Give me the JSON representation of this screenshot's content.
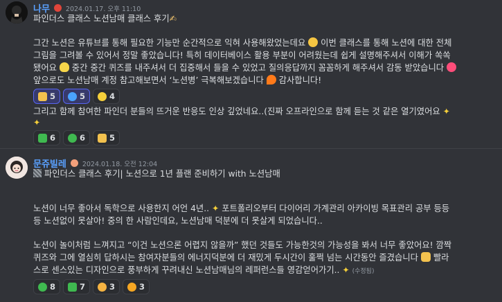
{
  "messages": [
    {
      "author": "나무",
      "timestamp": "2024.01.17. 오후 11:10",
      "lines": [
        "파인더스 클래스 노션남매 클래스 후기",
        "그간 노션은 유튜브를 통해 필요한 기능만 순간적으로 익혀 사용해왔었는데요",
        "이번 클래스를 통해 노션에 대한 전체",
        "그림을 그려볼 수 있어서 정말 좋았습니다! 특히 데이터베이스 활용 부분이 어려웠는데 쉽게 설명해주셔서 이해가 쏙쏙",
        "됐어요",
        "중간 중간 퀴즈를 내주셔서 더 집중해서 들을 수 있었고 질의응답까지 꼼꼼하게 해주셔서 감동 받았습니다",
        "앞으로도 노션남매 계정 참고해보면서 ‘노션병’ 극복해보겠습니다",
        "감사합니다!",
        "그리고 함께 참여한 파인더 분들의 뜨거운 반응도 인상 깊었네요..(진짜 오프라인으로 함께 듣는 것 같은 열기였어요"
      ],
      "reactions_row1": [
        {
          "icon": "thumbs-up",
          "count": "5"
        },
        {
          "icon": "blue-heart",
          "count": "5"
        },
        {
          "icon": "yellow-heart",
          "count": "4"
        }
      ],
      "reactions_row2": [
        {
          "icon": "sparkle",
          "count": "6"
        },
        {
          "icon": "green-heart",
          "count": "6"
        },
        {
          "icon": "thumbs-up",
          "count": "5"
        }
      ]
    },
    {
      "author": "문쥬빌레",
      "timestamp": "2024.01.18. 오전 12:04",
      "title": "파인더스 클래스 후기| 노션으로 1년 플랜 준비하기 with 노션남매",
      "lines": [
        "노션이 너무 좋아서 독학으로 사용한지 어언 4년..",
        "포트폴리오부터 다이어리 가계관리 아카이빙 목표관리 공부 등등",
        "등 노션없이 못살아! 중의 한 사람인데요, 노션남매 덕분에 더 못살게 되었습니다..",
        "노션이 놀이처럼 느껴지고 “이건 노션으론 어렵지 않을까” 했던 것들도 가능한것의 가능성을 봐서 너무 좋았어요! 깜짝",
        "퀴즈와 그에 열심히 답하시는 참여자분들의 에너지덕분에 더 재밌게 두시간이 훌쩍 넘는 시간동안 즐겼습니다",
        "빨라",
        "스로 센스있는 디자인으로 풍부하게 꾸려내신 노션남매님의 레퍼런스들 영감얻어가기..",
        "(수정됨)"
      ],
      "reactions": [
        {
          "icon": "green-heart",
          "count": "8"
        },
        {
          "icon": "sparkle",
          "count": "7"
        },
        {
          "icon": "smile-hearts",
          "count": "3"
        },
        {
          "icon": "sun",
          "count": "3"
        }
      ]
    }
  ],
  "colors": {
    "background": "#313338",
    "author": "#5aa1ff",
    "text": "#dbdee1",
    "timestamp": "#949ba4"
  }
}
